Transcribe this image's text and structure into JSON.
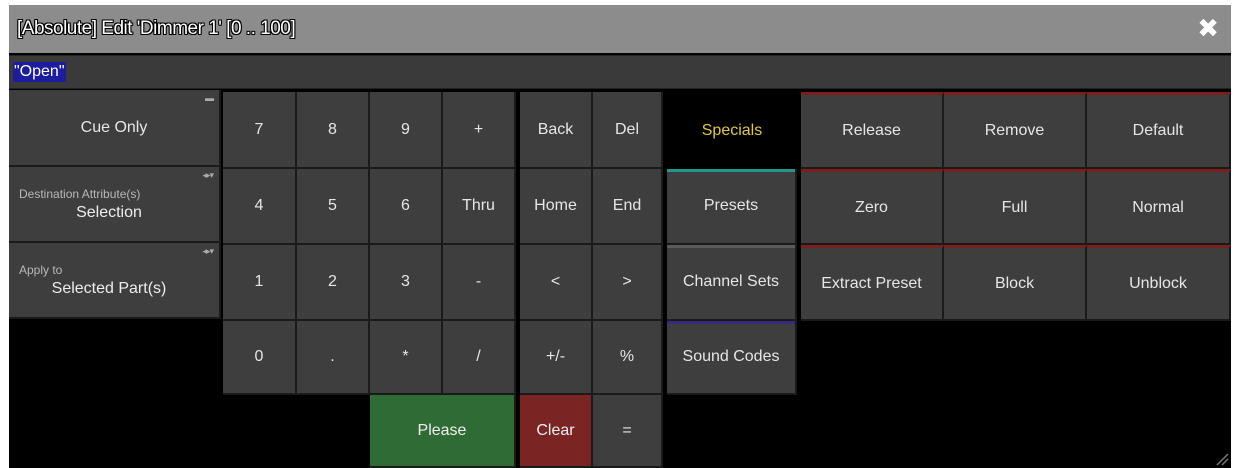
{
  "window": {
    "title": "[Absolute] Edit 'Dimmer 1' [0 .. 100]",
    "close_glyph": "✖",
    "close_icon": "close-icon"
  },
  "command_input": {
    "value": "\"Open\""
  },
  "left_options": {
    "cue_only": "Cue Only",
    "destination": {
      "caption": "Destination Attribute(s)",
      "value": "Selection"
    },
    "apply_to": {
      "caption": "Apply to",
      "value": "Selected Part(s)"
    }
  },
  "keypad": {
    "row1": [
      "7",
      "8",
      "9",
      "+"
    ],
    "row2": [
      "4",
      "5",
      "6",
      "Thru"
    ],
    "row3": [
      "1",
      "2",
      "3",
      "-"
    ],
    "row4": [
      "0",
      ".",
      "*",
      "/"
    ],
    "please": "Please"
  },
  "edit_keys": {
    "row1": [
      "Back",
      "Del"
    ],
    "row2": [
      "Home",
      "End"
    ],
    "row3": [
      "<",
      ">"
    ],
    "row4": [
      "+/-",
      "%"
    ],
    "clear": "Clear",
    "equals": "="
  },
  "tabs": [
    "Specials",
    "Presets",
    "Channel Sets",
    "Sound Codes"
  ],
  "specials": {
    "row1": [
      "Release",
      "Remove",
      "Default"
    ],
    "row2": [
      "Zero",
      "Full",
      "Normal"
    ],
    "row3": [
      "Extract Preset",
      "Block",
      "Unblock"
    ]
  },
  "colors": {
    "please": "#2f6b34",
    "clear": "#7a2424",
    "specials_text": "#e3c640",
    "selection": "#1c1c9c"
  }
}
